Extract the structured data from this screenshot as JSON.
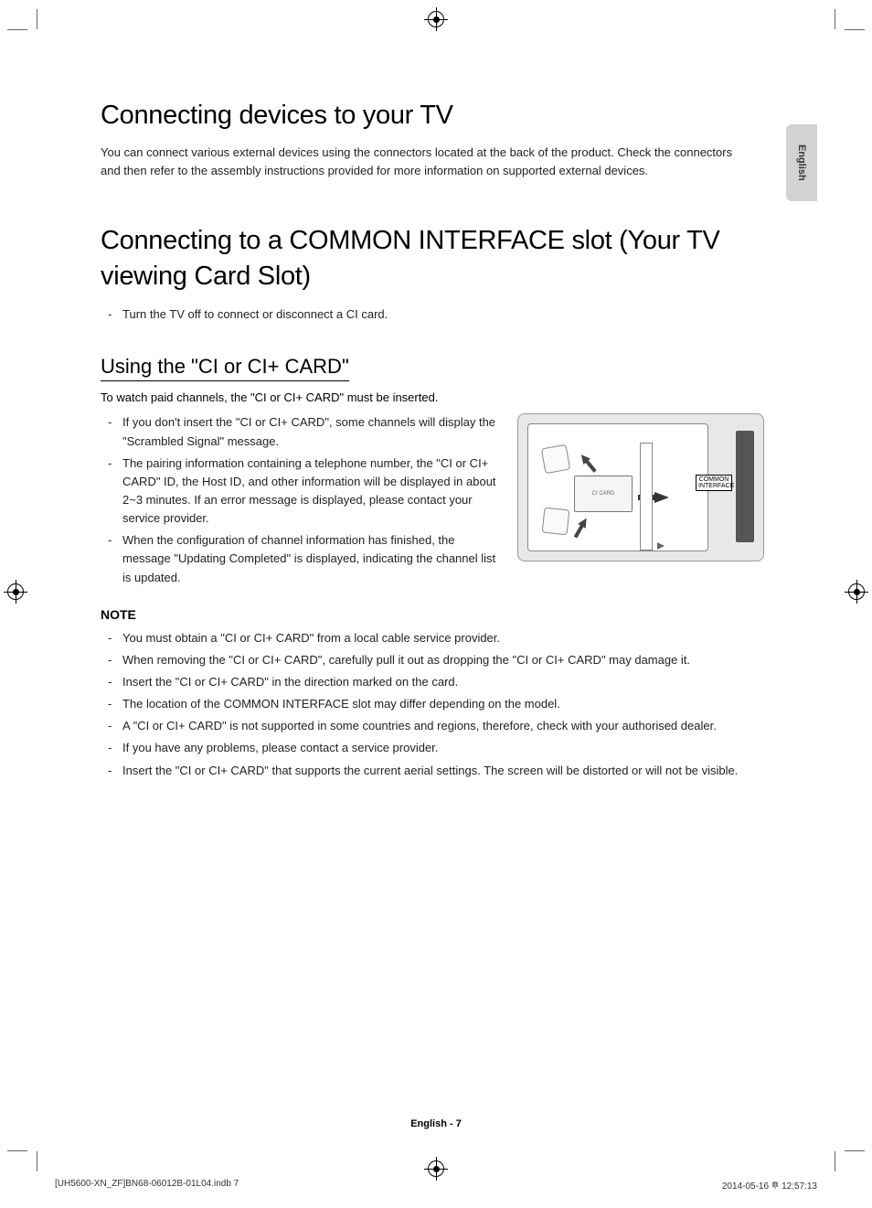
{
  "language_tab": "English",
  "heading1": "Connecting devices to your TV",
  "intro1": "You can connect various external devices using the connectors located at the back of the product. Check the connectors and then refer to the assembly instructions provided for more information on supported external devices.",
  "heading2": "Connecting to a COMMON INTERFACE slot (Your TV viewing Card Slot)",
  "list_h2": [
    "Turn the TV off to connect or disconnect a CI card."
  ],
  "subheading": "Using the \"CI or CI+ CARD\"",
  "sub_intro": "To watch paid channels, the \"CI or CI+ CARD\" must be inserted.",
  "sub_list": [
    "If you don't insert the \"CI or CI+ CARD\", some channels will display the \"Scrambled Signal\" message.",
    "The pairing information containing a telephone number, the \"CI or CI+ CARD\" ID, the Host ID, and other information will be displayed in about 2~3 minutes. If an error message is displayed, please contact your service provider.",
    "When the configuration of channel information has finished, the message \"Updating Completed\" is displayed, indicating the channel list is updated."
  ],
  "figure": {
    "card_label": "CI CARD",
    "slot_label": "COMMON INTERFACE"
  },
  "note_heading": "NOTE",
  "note_list": [
    "You must obtain a \"CI or CI+ CARD\" from a local cable service provider.",
    "When removing the \"CI or CI+ CARD\", carefully pull it out as dropping the \"CI or CI+ CARD\" may damage it.",
    "Insert the \"CI or CI+ CARD\" in the direction marked on the card.",
    "The location of the COMMON INTERFACE slot may differ depending on the model.",
    "A \"CI or CI+ CARD\" is not supported in some countries and regions, therefore, check with your authorised dealer.",
    "If you have any problems, please contact a service provider.",
    "Insert the \"CI or CI+ CARD\" that supports the current aerial settings. The screen will be distorted or will not be visible."
  ],
  "footer_page": "English - 7",
  "print_footer": {
    "left": "[UH5600-XN_ZF]BN68-06012B-01L04.indb   7",
    "right": "2014-05-16   𐄷 12:57:13"
  }
}
